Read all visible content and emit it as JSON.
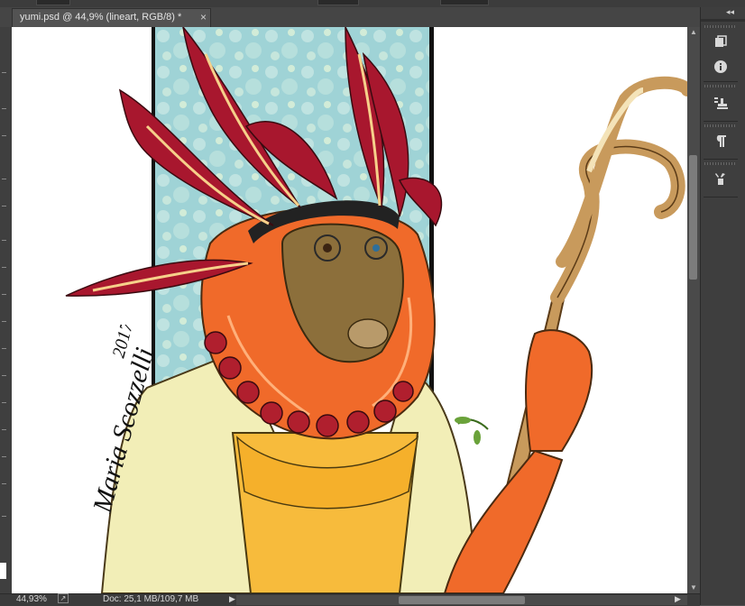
{
  "document": {
    "tab_title": "yumi.psd @ 44,9% (lineart, RGB/8) *",
    "close_glyph": "×"
  },
  "artwork": {
    "signature_name": "Maria Scozzelli",
    "signature_year": "2017",
    "colors": {
      "background_panel": "#9fd3d6",
      "feather_red": "#a8172e",
      "hair_orange": "#f06a2a",
      "face_brown": "#8c6f3b",
      "robe_cream": "#f2eeb7",
      "dress_yellow": "#f7bb3c",
      "beads_red": "#b01f2e",
      "staff_tan": "#c89a5c"
    }
  },
  "status_bar": {
    "zoom": "44,93%",
    "doc_size": "Doc: 25,1 MB/109,7 MB",
    "arrow_glyph": "▶"
  },
  "right_panel": {
    "collapse_glyph": "◂◂",
    "icons": [
      "layers-comp-icon",
      "info-icon",
      "clone-source-icon",
      "paragraph-icon",
      "tool-presets-icon"
    ]
  }
}
